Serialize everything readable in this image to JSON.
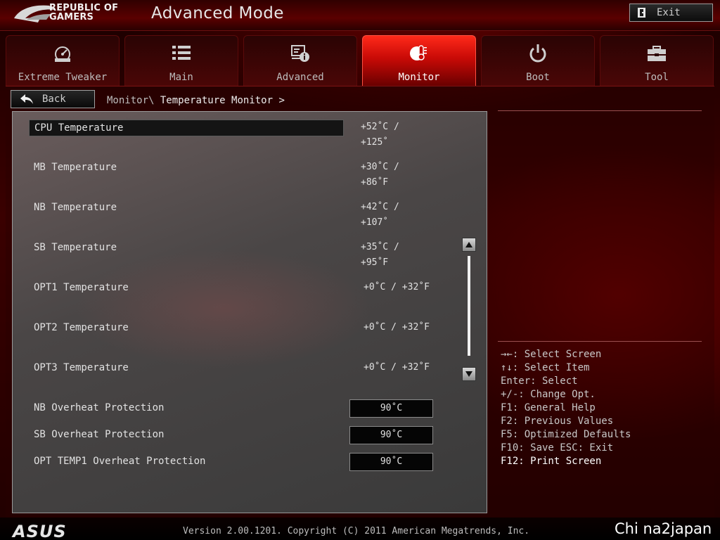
{
  "header": {
    "brand_line1": "REPUBLIC OF",
    "brand_line2": "GAMERS",
    "title": "Advanced Mode",
    "exit_label": "Exit"
  },
  "tabs": [
    {
      "label": "Extreme Tweaker",
      "icon": "gauge-icon",
      "active": false
    },
    {
      "label": "Main",
      "icon": "list-icon",
      "active": false
    },
    {
      "label": "Advanced",
      "icon": "info-chip-icon",
      "active": false
    },
    {
      "label": "Monitor",
      "icon": "thermometer-icon",
      "active": true
    },
    {
      "label": "Boot",
      "icon": "power-icon",
      "active": false
    },
    {
      "label": "Tool",
      "icon": "toolbox-icon",
      "active": false
    }
  ],
  "nav": {
    "back_label": "Back",
    "breadcrumb_parent": "Monitor\\",
    "breadcrumb_current": "Temperature Monitor >"
  },
  "rows": [
    {
      "label": "CPU Temperature",
      "value": "+52˚C / +125˚"
    },
    {
      "label": "MB Temperature",
      "value": "+30˚C / +86˚F"
    },
    {
      "label": "NB Temperature",
      "value": "+42˚C / +107˚"
    },
    {
      "label": "SB Temperature",
      "value": "+35˚C / +95˚F"
    },
    {
      "label": "OPT1 Temperature",
      "value": "+0˚C / +32˚F"
    },
    {
      "label": "OPT2 Temperature",
      "value": "+0˚C / +32˚F"
    },
    {
      "label": "OPT3 Temperature",
      "value": "+0˚C / +32˚F"
    }
  ],
  "protection": [
    {
      "label": "NB Overheat Protection",
      "value": "90˚C"
    },
    {
      "label": "SB Overheat Protection",
      "value": "90˚C"
    },
    {
      "label": "OPT TEMP1 Overheat Protection",
      "value": "90˚C"
    }
  ],
  "help": [
    {
      "text": "→←: Select Screen"
    },
    {
      "text": "↑↓: Select Item"
    },
    {
      "text": "Enter: Select"
    },
    {
      "text": "+/-: Change Opt."
    },
    {
      "text": "F1: General Help"
    },
    {
      "text": "F2: Previous Values"
    },
    {
      "text": "F5: Optimized Defaults"
    },
    {
      "text": "F10: Save  ESC: Exit"
    },
    {
      "text": "F12: Print Screen"
    }
  ],
  "footer": {
    "logo": "ASUS",
    "version": "Version 2.00.1201. Copyright (C) 2011 American Megatrends, Inc.",
    "watermark": "Chi na2japan"
  },
  "colors": {
    "accent_red": "#e0140a",
    "panel_gray": "#4a4646",
    "selection_black": "#141414"
  }
}
